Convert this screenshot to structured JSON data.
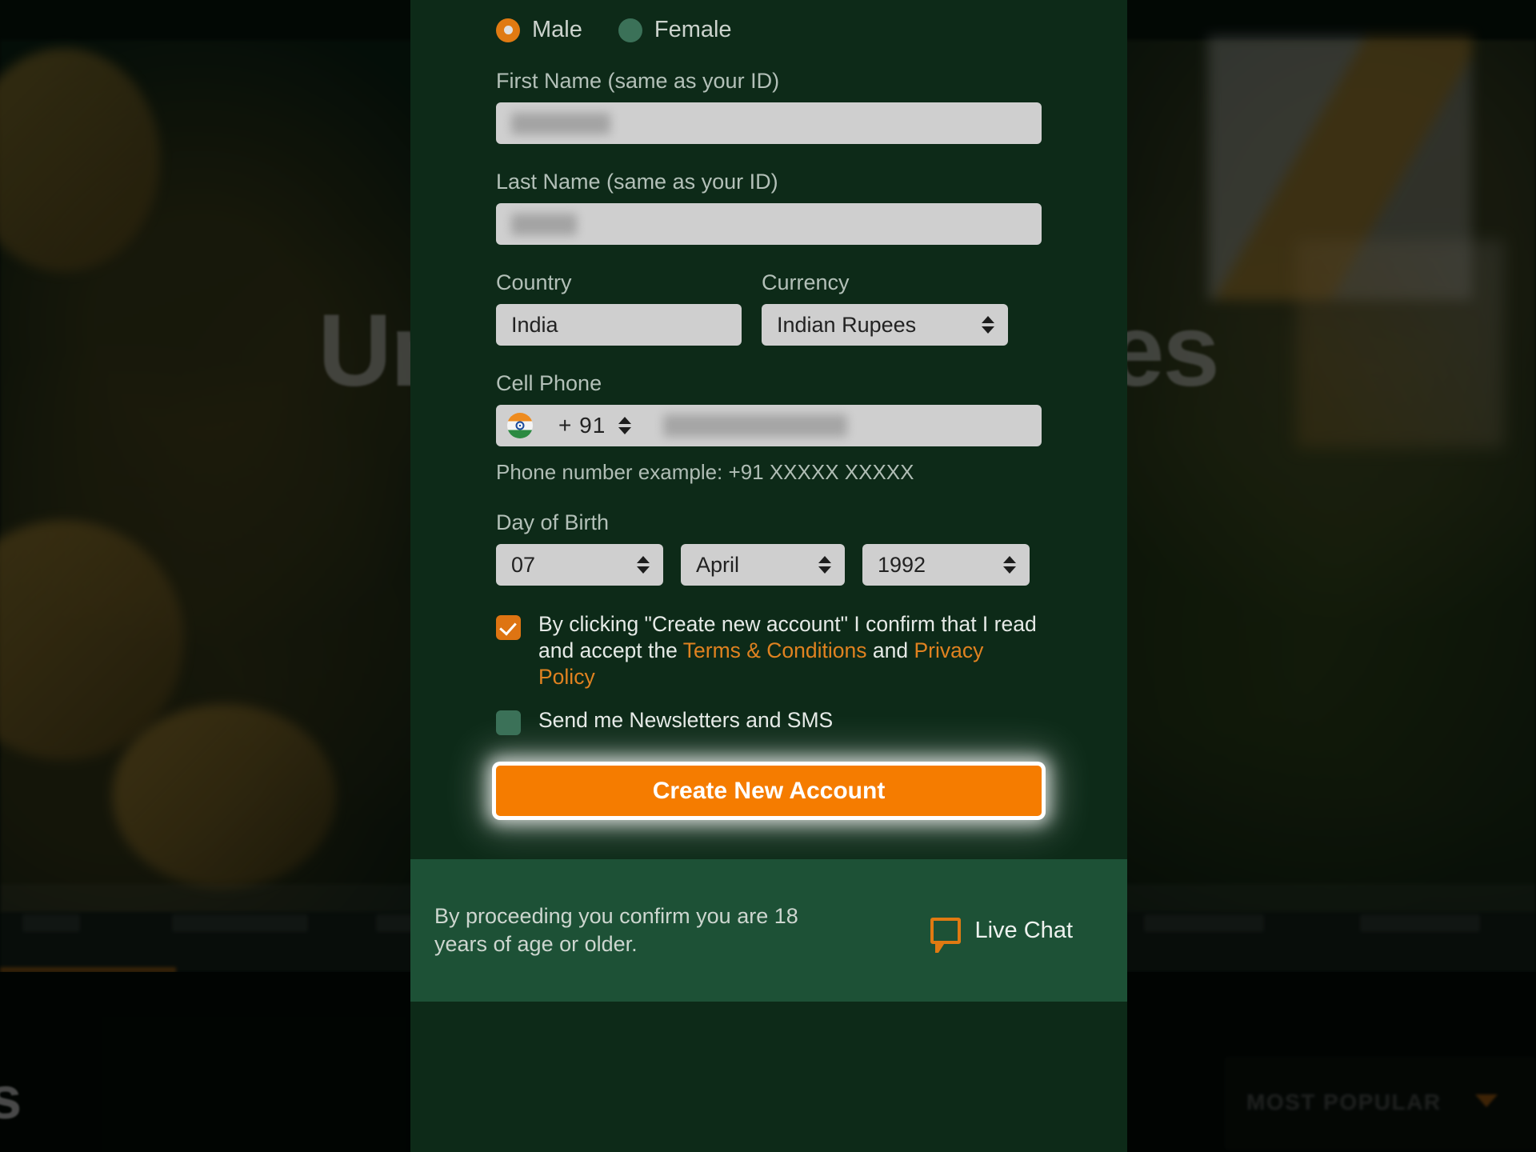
{
  "background": {
    "headline": "Unlimited Bonuses",
    "bottom_word": "s",
    "most_popular_label": "MOST POPULAR"
  },
  "modal": {
    "gender": {
      "options": [
        {
          "label": "Male",
          "selected": true
        },
        {
          "label": "Female",
          "selected": false
        }
      ]
    },
    "first_name": {
      "label": "First Name (same as your ID)",
      "value": "",
      "redacted": true
    },
    "last_name": {
      "label": "Last Name (same as your ID)",
      "value": "",
      "redacted": true
    },
    "country": {
      "label": "Country",
      "value": "India"
    },
    "currency": {
      "label": "Currency",
      "value": "Indian Rupees"
    },
    "cell_phone": {
      "label": "Cell Phone",
      "flag": "india-flag-icon",
      "dial_code": "+ 91",
      "number": "",
      "redacted": true,
      "hint": "Phone number example: +91 XXXXX XXXXX"
    },
    "day_of_birth": {
      "label": "Day of Birth",
      "day": "07",
      "month": "April",
      "year": "1992"
    },
    "terms": {
      "checked": true,
      "text_part1": "By clicking \"Create new account\" I confirm that I read and accept the ",
      "link1": "Terms & Conditions",
      "text_part2": " and ",
      "link2": "Privacy Policy"
    },
    "newsletter": {
      "checked": false,
      "label": "Send me Newsletters and SMS"
    },
    "submit": {
      "label": "Create New Account",
      "focused": true
    },
    "footer": {
      "age_notice": "By proceeding you confirm you are 18 years of age or older.",
      "live_chat_label": "Live Chat"
    }
  },
  "colors": {
    "modal_bg": "#0d2a18",
    "footer_bg": "#1d5136",
    "accent_orange": "#e07a12",
    "cta_orange": "#f57c00",
    "muted_green": "#3b7158",
    "input_bg": "#cfcfcf"
  }
}
